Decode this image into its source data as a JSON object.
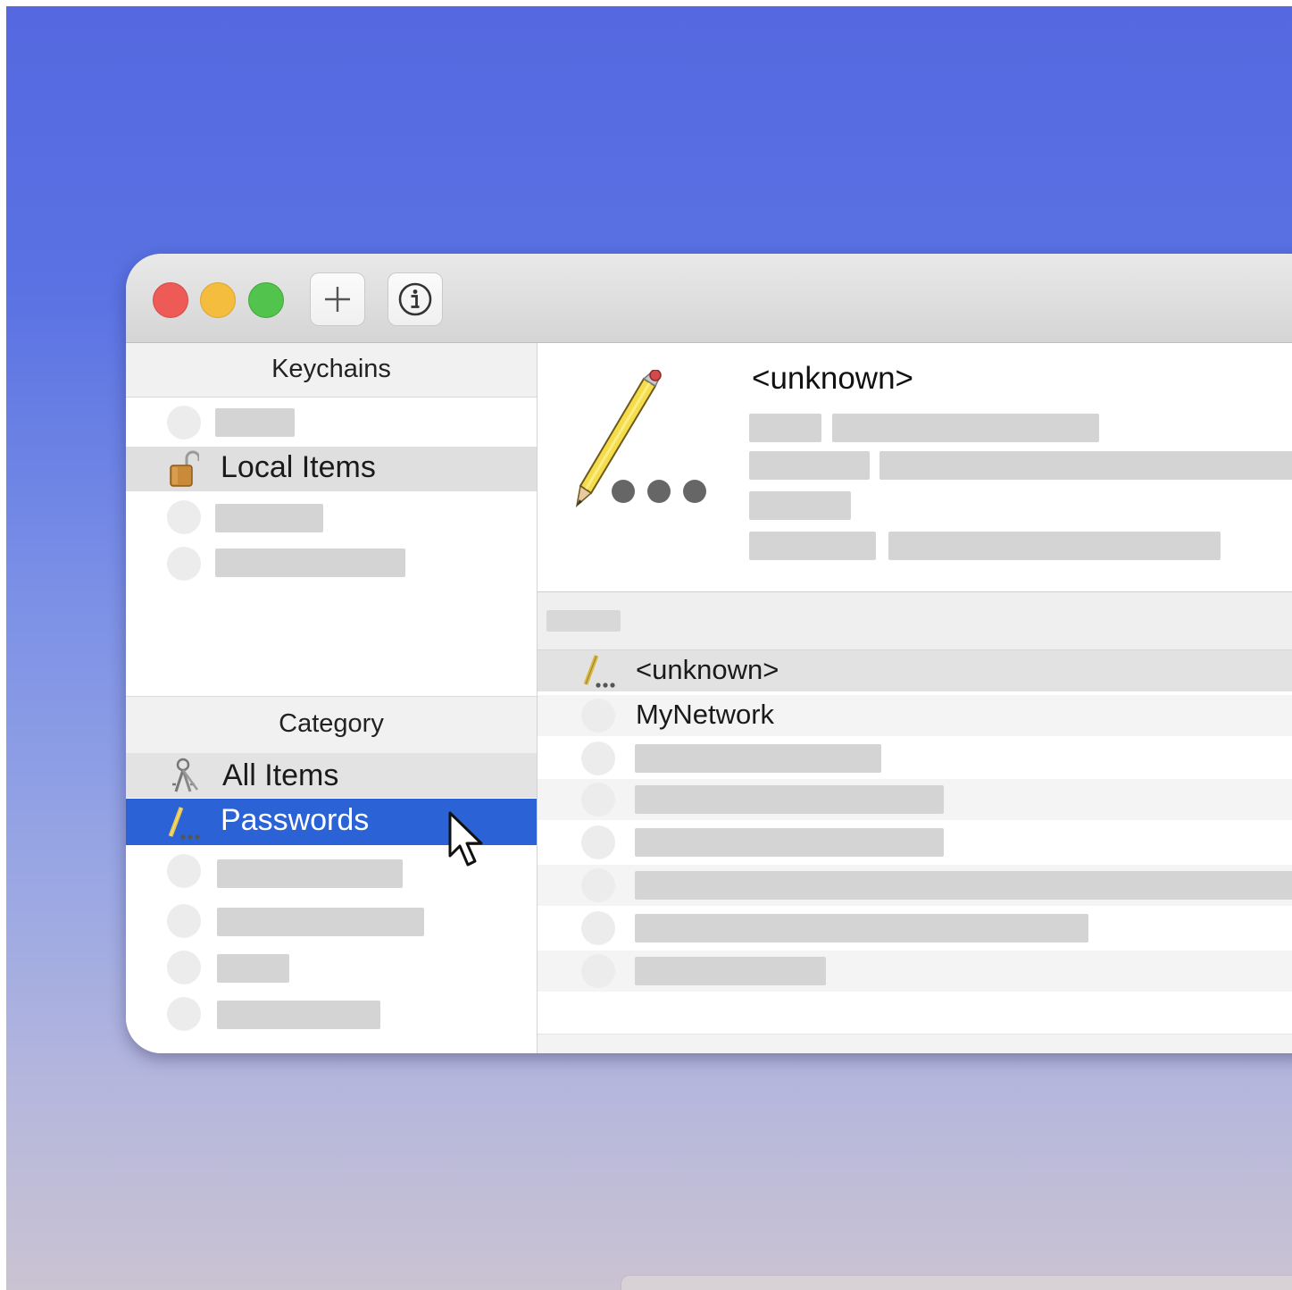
{
  "toolbar": {
    "add_button_icon": "plus-icon",
    "info_button_icon": "info-icon"
  },
  "sidebar": {
    "keychains_header": "Keychains",
    "keychains": [
      {
        "label": "",
        "icon": "placeholder-circle"
      },
      {
        "label": "Local Items",
        "icon": "unlocked-padlock-icon",
        "selected": true
      },
      {
        "label": "",
        "icon": "placeholder-circle"
      },
      {
        "label": "",
        "icon": "placeholder-circle"
      }
    ],
    "category_header": "Category",
    "categories": [
      {
        "label": "All Items",
        "icon": "keys-icon"
      },
      {
        "label": "Passwords",
        "icon": "password-pencil-icon",
        "selected": true
      },
      {
        "label": "",
        "icon": "placeholder-circle"
      },
      {
        "label": "",
        "icon": "placeholder-circle"
      },
      {
        "label": "",
        "icon": "placeholder-circle"
      },
      {
        "label": "",
        "icon": "placeholder-circle"
      }
    ]
  },
  "detail": {
    "icon": "password-pencil-icon",
    "title": "<unknown>"
  },
  "items": [
    {
      "label": "<unknown>",
      "icon": "password-pencil-icon",
      "selected": true
    },
    {
      "label": "MyNetwork",
      "icon": "placeholder-circle"
    },
    {
      "label": "",
      "icon": "placeholder-circle"
    },
    {
      "label": "",
      "icon": "placeholder-circle"
    },
    {
      "label": "",
      "icon": "placeholder-circle"
    },
    {
      "label": "",
      "icon": "placeholder-circle"
    },
    {
      "label": "",
      "icon": "placeholder-circle"
    },
    {
      "label": "",
      "icon": "placeholder-circle"
    }
  ],
  "colors": {
    "selection_blue": "#2b63d6",
    "close": "#ee5a55",
    "minimize": "#f5bd3e",
    "zoom": "#52c34d"
  }
}
